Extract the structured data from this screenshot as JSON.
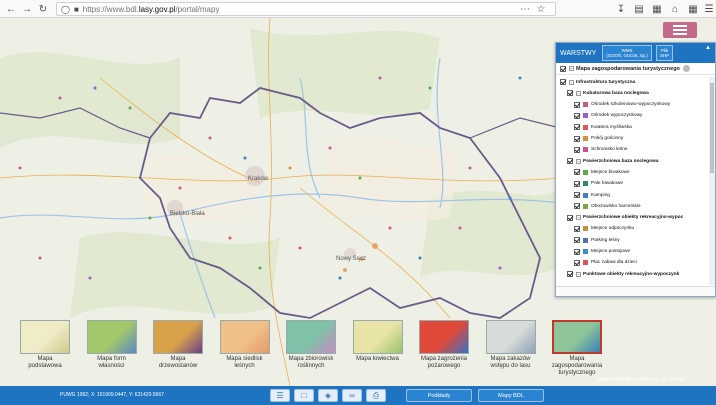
{
  "browser": {
    "url_prefix": "https://www.bdl.",
    "url_domain": "lasy.gov.pl",
    "url_path": "/portal/mapy",
    "icons": [
      "back-icon",
      "forward-icon",
      "reload-icon",
      "shield-icon",
      "lock-icon",
      "page-actions-icon",
      "bookmark-star-icon",
      "download-icon",
      "library-icon",
      "reader-icon",
      "home-icon",
      "extension-icon"
    ]
  },
  "map": {
    "towns": [
      {
        "name": "Kraków"
      },
      {
        "name": "Nowy Sącz"
      },
      {
        "name": "Bielsko-Biała"
      }
    ]
  },
  "layers_panel": {
    "header_label": "WARSTWY",
    "tabs": [
      {
        "line1": "WMS",
        "line2": "(GDOŚ, GUGiK, itp.)"
      },
      {
        "line1": "Plik",
        "line2": "SHP"
      }
    ],
    "map_title": "Mapa zagospodarowania turystycznego",
    "tree": [
      {
        "label": "Infrastruktura turystyczna",
        "level": 0,
        "checked": true,
        "group": true
      },
      {
        "label": "Kubaturowa baza noclegowa",
        "level": 1,
        "checked": true,
        "group": true
      },
      {
        "label": "Ośrodek szkoleniowo-wypoczynkowy",
        "level": 2,
        "checked": true,
        "color": "#c25b91"
      },
      {
        "label": "Ośrodek wypoczynkowy",
        "level": 2,
        "checked": true,
        "color": "#9a5ec4"
      },
      {
        "label": "Kwatera myśliwska",
        "level": 2,
        "checked": true,
        "color": "#e05757"
      },
      {
        "label": "Pokój gościnny",
        "level": 2,
        "checked": true,
        "color": "#d98f3a"
      },
      {
        "label": "Schronisko leśne",
        "level": 2,
        "checked": true,
        "color": "#cf4f9b"
      },
      {
        "label": "Powierzchniowa baza noclegowa",
        "level": 1,
        "checked": true,
        "group": true
      },
      {
        "label": "Miejsce biwakowe",
        "level": 2,
        "checked": true,
        "color": "#5bab4a"
      },
      {
        "label": "Pole biwakowe",
        "level": 2,
        "checked": true,
        "color": "#2e8c57"
      },
      {
        "label": "Kamping",
        "level": 2,
        "checked": true,
        "color": "#3f7fc4"
      },
      {
        "label": "Obozowisko harcerskie",
        "level": 2,
        "checked": true,
        "color": "#7aa843"
      },
      {
        "label": "Powierzchniowe obiekty rekreacyjno-wypoc",
        "level": 1,
        "checked": true,
        "group": true
      },
      {
        "label": "Miejsce odpoczynku",
        "level": 2,
        "checked": true,
        "color": "#c4943a"
      },
      {
        "label": "Parking leśny",
        "level": 2,
        "checked": true,
        "color": "#4f6fb8"
      },
      {
        "label": "Miejsce postojowe",
        "level": 2,
        "checked": true,
        "color": "#3a8fc4"
      },
      {
        "label": "Plac zabaw dla dzieci",
        "level": 2,
        "checked": true,
        "color": "#d9534f"
      },
      {
        "label": "Punktowe obiekty rekreacyjno-wypoczynk",
        "level": 1,
        "checked": true,
        "group": true
      }
    ]
  },
  "basemaps": [
    {
      "line1": "Mapa",
      "line2": "podstawowa",
      "line3": "",
      "colors": [
        "#f1ecc8",
        "#cfc98a"
      ],
      "selected": false
    },
    {
      "line1": "Mapa form",
      "line2": "własności",
      "line3": "",
      "colors": [
        "#a3c86b",
        "#5a87c4"
      ],
      "selected": false
    },
    {
      "line1": "Mapa",
      "line2": "drzewostanów",
      "line3": "",
      "colors": [
        "#d9a24a",
        "#6b3f8a"
      ],
      "selected": false
    },
    {
      "line1": "Mapa siedlisk",
      "line2": "leśnych",
      "line3": "",
      "colors": [
        "#f0c089",
        "#e59a6a"
      ],
      "selected": false
    },
    {
      "line1": "Mapa zbiorowisk",
      "line2": "roślinnych",
      "line3": "",
      "colors": [
        "#7fc2a8",
        "#c98ac4"
      ],
      "selected": false
    },
    {
      "line1": "Mapa łowiectwa",
      "line2": "",
      "line3": "",
      "colors": [
        "#e8e4a8",
        "#9bc26b"
      ],
      "selected": false
    },
    {
      "line1": "Mapa zagrożenia",
      "line2": "pożarowego",
      "line3": "",
      "colors": [
        "#e04a3a",
        "#3a6fc4"
      ],
      "selected": false
    },
    {
      "line1": "Mapa zakazów",
      "line2": "wstępu do lasu",
      "line3": "",
      "colors": [
        "#d8dcd8",
        "#8fa0b8"
      ],
      "selected": false
    },
    {
      "line1": "Mapa",
      "line2": "zagospodarowania",
      "line3": "turystycznego",
      "colors": [
        "#8ec49a",
        "#3a7fb8"
      ],
      "selected": true
    }
  ],
  "bottom_bar": {
    "coords": "PUWG 1992; X: 151909.0447, Y: 631420.5667",
    "tools": [
      "list-icon",
      "copy-icon",
      "layers-icon",
      "link-icon",
      "print-icon"
    ],
    "buttons": {
      "podklady": "Podkłady",
      "mapy": "Mapy BDL"
    },
    "attribution": "OpenStreetMap contributors, CC-BY-SA"
  },
  "colors": {
    "accent": "#1e74c1",
    "menu": "#c26a8a",
    "border": "#6a5a8a"
  }
}
